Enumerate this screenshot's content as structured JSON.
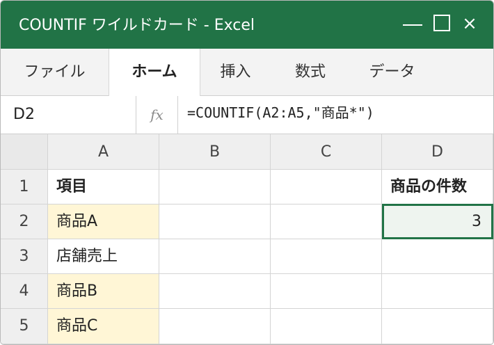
{
  "window": {
    "title": "COUNTIF ワイルドカード - Excel",
    "controls": {
      "minimize": "—",
      "maximize": "☐",
      "close": "×"
    }
  },
  "ribbon": {
    "tabs": [
      {
        "label": "ファイル",
        "active": false
      },
      {
        "label": "ホーム",
        "active": true
      },
      {
        "label": "挿入",
        "active": false
      },
      {
        "label": "数式",
        "active": false
      },
      {
        "label": "データ",
        "active": false
      }
    ]
  },
  "formula_bar": {
    "name_box": "D2",
    "fx_label": "fx",
    "formula": "=COUNTIF(A2:A5,\"商品*\")"
  },
  "sheet": {
    "columns": [
      "A",
      "B",
      "C",
      "D"
    ],
    "rows": [
      {
        "row": "1",
        "cells": [
          "項目",
          "",
          "",
          "商品の件数"
        ]
      },
      {
        "row": "2",
        "cells": [
          "商品A",
          "",
          "",
          "3"
        ]
      },
      {
        "row": "3",
        "cells": [
          "店舗売上",
          "",
          "",
          ""
        ]
      },
      {
        "row": "4",
        "cells": [
          "商品B",
          "",
          "",
          ""
        ]
      },
      {
        "row": "5",
        "cells": [
          "商品C",
          "",
          "",
          ""
        ]
      }
    ],
    "selected_cell": "D2",
    "highlight_color": "#fff6d6",
    "accent_color": "#217346"
  }
}
